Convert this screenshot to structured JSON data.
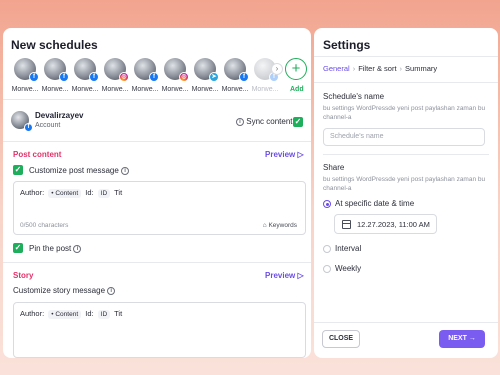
{
  "left_panel": {
    "title": "New schedules",
    "accounts": [
      {
        "label": "Morwe...",
        "network": "facebook"
      },
      {
        "label": "Morwe...",
        "network": "facebook"
      },
      {
        "label": "Morwe...",
        "network": "facebook"
      },
      {
        "label": "Morwe...",
        "network": "instagram"
      },
      {
        "label": "Morwe...",
        "network": "facebook"
      },
      {
        "label": "Morwe...",
        "network": "instagram"
      },
      {
        "label": "Morwe...",
        "network": "telegram"
      },
      {
        "label": "Morwe...",
        "network": "facebook"
      },
      {
        "label": "Morwe...",
        "network": "facebook"
      }
    ],
    "add_label": "Add",
    "selected_account": {
      "name": "Devalirzayev",
      "type": "Account"
    },
    "sync_label": "Sync content",
    "post_content": {
      "heading": "Post content",
      "preview_label": "Preview",
      "customize_label": "Customize post message",
      "template": {
        "author_label": "Author:",
        "author_chip": "• Content",
        "id_label": "Id:",
        "id_chip": "ID",
        "title_text": "Tit"
      },
      "counter": "0/500 characters",
      "keywords_label": "Keywords",
      "pin_label": "Pin the post"
    },
    "story": {
      "heading": "Story",
      "preview_label": "Preview",
      "customize_label": "Customize story message",
      "template": {
        "author_label": "Author:",
        "author_chip": "• Content",
        "id_label": "Id:",
        "id_chip": "ID",
        "title_text": "Tit"
      }
    }
  },
  "right_panel": {
    "title": "Settings",
    "steps": [
      "General",
      "Filter & sort",
      "Summary"
    ],
    "schedule_name": {
      "title": "Schedule's name",
      "description": "bu settings WordPressde yeni post paylashan zaman bu channel-a",
      "placeholder": "Schedule's name"
    },
    "share": {
      "title": "Share",
      "description": "bu settings WordPressde yeni post paylashan zaman bu channel-a",
      "options": [
        "At specific date & time",
        "Interval",
        "Weekly"
      ],
      "selected": "At specific date & time",
      "datetime": "12.27.2023, 11:00 AM"
    },
    "close_label": "CLOSE",
    "next_label": "NEXT"
  },
  "colors": {
    "accent": "#7b5cf0",
    "success": "#1fae5b",
    "danger": "#e0336a"
  }
}
